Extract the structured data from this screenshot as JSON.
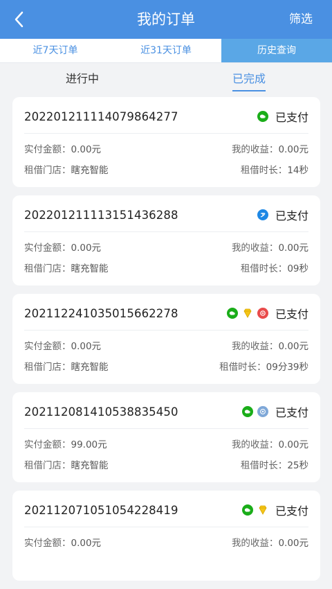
{
  "header": {
    "title": "我的订单",
    "filter_label": "筛选"
  },
  "tabs": [
    {
      "label": "近7天订单"
    },
    {
      "label": "近31天订单"
    },
    {
      "label": "历史查询"
    }
  ],
  "subtabs": {
    "ongoing": "进行中",
    "completed": "已完成"
  },
  "orders": [
    {
      "order_no": "20220121111407986427 7",
      "status": "已支付",
      "paid_label": "实付金额：",
      "paid": "0.00元",
      "income_label": "我的收益：",
      "income": "0.00元",
      "store_label": "租借门店：",
      "store": "瞎充智能",
      "duration_label": "租借时长：",
      "duration": "14秒",
      "icons": [
        "wechat-pay-icon"
      ]
    },
    {
      "order_no": "20220121111315143628 8",
      "status": "已支付",
      "paid_label": "实付金额：",
      "paid": "0.00元",
      "income_label": "我的收益：",
      "income": "0.00元",
      "store_label": "租借门店：",
      "store": "瞎充智能",
      "duration_label": "租借时长：",
      "duration": "09秒",
      "icons": [
        "alipay-icon"
      ]
    },
    {
      "order_no": "20211224103501566227 8",
      "status": "已支付",
      "paid_label": "实付金额：",
      "paid": "0.00元",
      "income_label": "我的收益：",
      "income": "0.00元",
      "store_label": "租借门店：",
      "store": "瞎充智能",
      "duration_label": "租借时长：",
      "duration": "09分39秒",
      "icons": [
        "wechat-pay-icon",
        "vip-diamond-icon",
        "coupon-icon"
      ]
    },
    {
      "order_no": "20211208141053883545 0",
      "status": "已支付",
      "paid_label": "实付金额：",
      "paid": "99.00元",
      "income_label": "我的收益：",
      "income": "0.00元",
      "store_label": "租借门店：",
      "store": "瞎充智能",
      "duration_label": "租借时长：",
      "duration": "25秒",
      "icons": [
        "wechat-pay-icon",
        "card-icon"
      ]
    },
    {
      "order_no": "20211207105105422841 9",
      "status": "已支付",
      "paid_label": "实付金额：",
      "paid": "0.00元",
      "income_label": "我的收益：",
      "income": "0.00元",
      "store_label": "",
      "store": "",
      "duration_label": "",
      "duration": "",
      "icons": [
        "wechat-pay-icon",
        "vip-diamond-icon"
      ]
    }
  ],
  "colors": {
    "primary": "#4a90e2",
    "tab_active": "#5aa7e6",
    "wechat": "#1aad19",
    "gold": "#f5c518",
    "red": "#e94b4b"
  }
}
